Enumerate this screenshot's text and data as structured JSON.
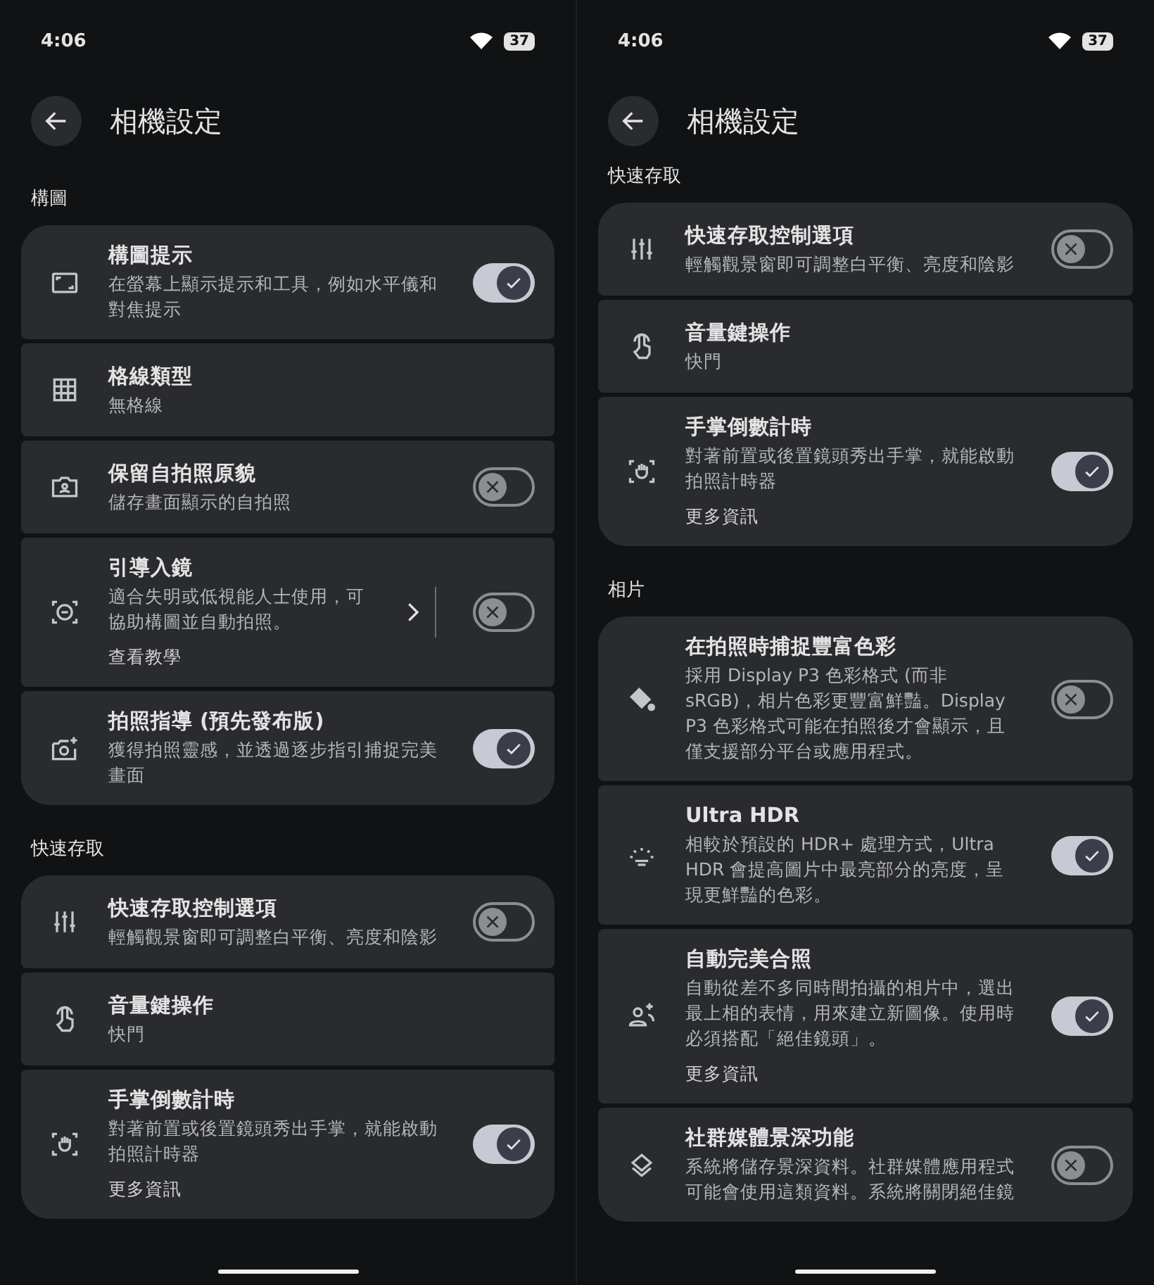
{
  "panes": [
    {
      "status_bar": {
        "time": "4:06",
        "battery": "37"
      },
      "title": "相機設定",
      "sections": [
        {
          "header": "構圖",
          "items": [
            {
              "kind": "switch",
              "title": "構圖提示",
              "subtitle": "在螢幕上顯示提示和工具，例如水平儀和對焦提示",
              "on": true
            },
            {
              "kind": "plain",
              "title": "格線類型",
              "subtitle": "無格線"
            },
            {
              "kind": "switch",
              "title": "保留自拍照原貌",
              "subtitle": "儲存畫面顯示的自拍照",
              "on": false
            },
            {
              "kind": "link_switch",
              "title": "引導入鏡",
              "subtitle": "適合失明或低視能人士使用，可協助構圖並自動拍照。",
              "link": "查看教學",
              "on": false
            },
            {
              "kind": "switch",
              "title": "拍照指導 (預先發布版)",
              "subtitle": "獲得拍照靈感，並透過逐步指引捕捉完美畫面",
              "on": true
            }
          ]
        },
        {
          "header": "快速存取",
          "items": [
            {
              "kind": "switch",
              "title": "快速存取控制選項",
              "subtitle": "輕觸觀景窗即可調整白平衡、亮度和陰影",
              "on": false
            },
            {
              "kind": "plain",
              "title": "音量鍵操作",
              "subtitle": "快門"
            },
            {
              "kind": "switch",
              "title": "手掌倒數計時",
              "subtitle": "對著前置或後置鏡頭秀出手掌，就能啟動拍照計時器",
              "link": "更多資訊",
              "on": true
            }
          ]
        }
      ]
    },
    {
      "status_bar": {
        "time": "4:06",
        "battery": "37"
      },
      "title": "相機設定",
      "sections": [
        {
          "header": "快速存取",
          "items": [
            {
              "kind": "switch",
              "title": "快速存取控制選項",
              "subtitle": "輕觸觀景窗即可調整白平衡、亮度和陰影",
              "on": false
            },
            {
              "kind": "plain",
              "title": "音量鍵操作",
              "subtitle": "快門"
            },
            {
              "kind": "switch",
              "title": "手掌倒數計時",
              "subtitle": "對著前置或後置鏡頭秀出手掌，就能啟動拍照計時器",
              "link": "更多資訊",
              "on": true
            }
          ]
        },
        {
          "header": "相片",
          "items": [
            {
              "kind": "switch",
              "title": "在拍照時捕捉豐富色彩",
              "subtitle": "採用 Display P3 色彩格式 (而非 sRGB)，相片色彩更豐富鮮豔。Display P3 色彩格式可能在拍照後才會顯示，且僅支援部分平台或應用程式。",
              "on": false
            },
            {
              "kind": "switch",
              "title": "Ultra HDR",
              "subtitle": "相較於預設的 HDR+ 處理方式，Ultra HDR 會提高圖片中最亮部分的亮度，呈現更鮮豔的色彩。",
              "on": true
            },
            {
              "kind": "switch",
              "title": "自動完美合照",
              "subtitle": "自動從差不多同時間拍攝的相片中，選出最上相的表情，用來建立新圖像。使用時必須搭配「絕佳鏡頭」。",
              "link": "更多資訊",
              "on": true
            },
            {
              "kind": "switch",
              "title": "社群媒體景深功能",
              "subtitle": "系統將儲存景深資料。社群媒體應用程式可能會使用這類資料。系統將關閉絕佳鏡",
              "on": false
            }
          ]
        }
      ]
    }
  ]
}
